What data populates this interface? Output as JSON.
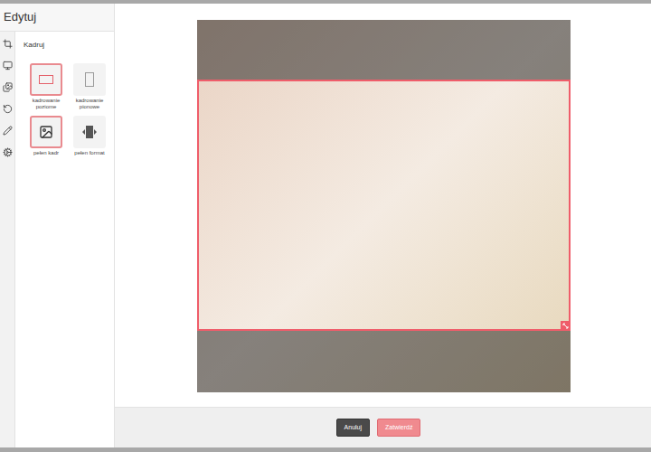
{
  "header": {
    "title": "Edytuj"
  },
  "section": {
    "title": "Kadruj"
  },
  "options": [
    {
      "label": "kadrowanie poziome",
      "kind": "landscape",
      "selected": true
    },
    {
      "label": "kadrowanie pionowe",
      "kind": "portrait",
      "selected": false
    },
    {
      "label": "pełen kadr",
      "kind": "image",
      "selected": true
    },
    {
      "label": "pełen format",
      "kind": "format",
      "selected": false
    }
  ],
  "buttons": [
    {
      "label": "Anuluj",
      "kind": "secondary"
    },
    {
      "label": "Zatwierdź",
      "kind": "primary"
    }
  ]
}
